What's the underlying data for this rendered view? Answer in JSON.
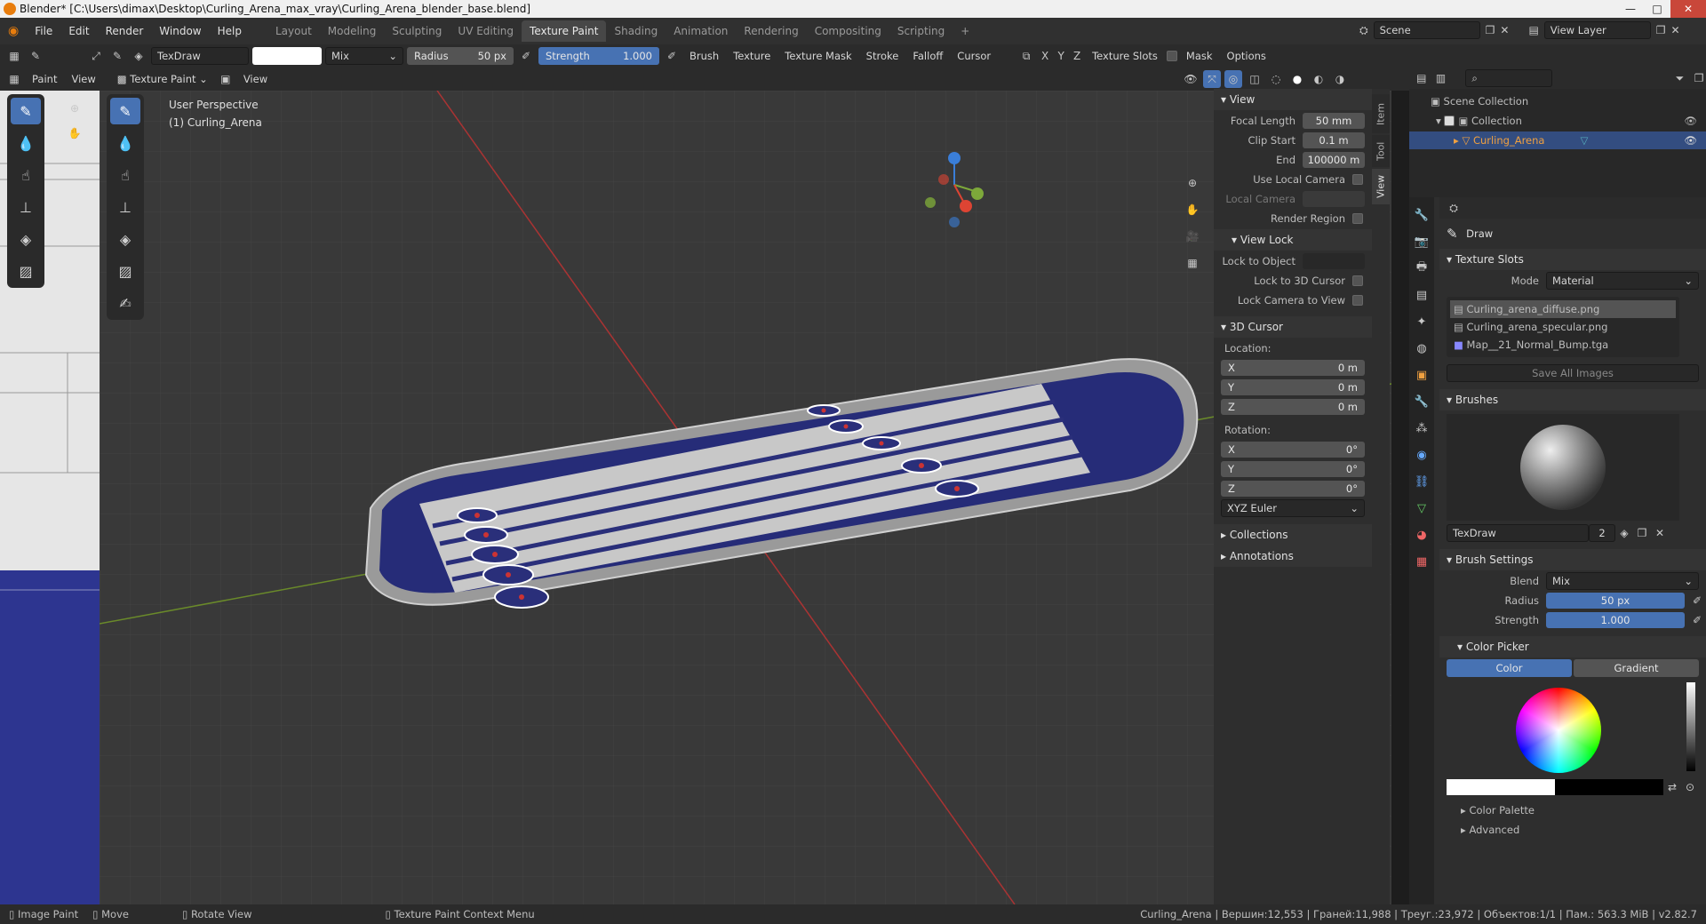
{
  "window": {
    "title": "Blender* [C:\\Users\\dimax\\Desktop\\Curling_Arena_max_vray\\Curling_Arena_blender_base.blend]",
    "minimize": "—",
    "maximize": "□",
    "close": "✕"
  },
  "menu": [
    "File",
    "Edit",
    "Render",
    "Window",
    "Help"
  ],
  "workspaces": [
    "Layout",
    "Modeling",
    "Sculpting",
    "UV Editing",
    "Texture Paint",
    "Shading",
    "Animation",
    "Rendering",
    "Compositing",
    "Scripting",
    "+"
  ],
  "active_workspace": "Texture Paint",
  "scene": {
    "name": "Scene",
    "view_layer": "View Layer"
  },
  "toolbar": {
    "brush_name": "TexDraw",
    "blend": "Mix",
    "radius_label": "Radius",
    "radius_value": "50 px",
    "strength_label": "Strength",
    "strength_value": "1.000",
    "menus": [
      "Brush",
      "Texture",
      "Texture Mask",
      "Stroke",
      "Falloff",
      "Cursor"
    ],
    "axes": [
      "X",
      "Y",
      "Z"
    ],
    "texture_slots": "Texture Slots",
    "mask": "Mask",
    "options": "Options"
  },
  "header2": {
    "mode_left": "Paint",
    "view_left": "View",
    "mode": "Texture Paint",
    "view": "View"
  },
  "viewport": {
    "perspective": "User Perspective",
    "object": "(1) Curling_Arena"
  },
  "npanel": {
    "tabs": [
      "Item",
      "Tool",
      "View"
    ],
    "view_section": "View",
    "focal_length_label": "Focal Length",
    "focal_length": "50 mm",
    "clip_start_label": "Clip Start",
    "clip_start": "0.1 m",
    "clip_end_label": "End",
    "clip_end": "100000 m",
    "use_local_camera": "Use Local Camera",
    "local_camera": "Local Camera",
    "render_region": "Render Region",
    "view_lock_section": "View Lock",
    "lock_to_object": "Lock to Object",
    "lock_3d_cursor": "Lock to 3D Cursor",
    "lock_camera": "Lock Camera to View",
    "cursor_section": "3D Cursor",
    "location": "Location:",
    "loc": [
      {
        "axis": "X",
        "val": "0 m"
      },
      {
        "axis": "Y",
        "val": "0 m"
      },
      {
        "axis": "Z",
        "val": "0 m"
      }
    ],
    "rotation": "Rotation:",
    "rot": [
      {
        "axis": "X",
        "val": "0°"
      },
      {
        "axis": "Y",
        "val": "0°"
      },
      {
        "axis": "Z",
        "val": "0°"
      }
    ],
    "rot_mode": "XYZ Euler",
    "collections": "Collections",
    "annotations": "Annotations"
  },
  "outliner": {
    "scene_collection": "Scene Collection",
    "collection": "Collection",
    "object": "Curling_Arena"
  },
  "properties": {
    "tool_name": "Draw",
    "texture_slots": "Texture Slots",
    "mode_label": "Mode",
    "mode": "Material",
    "slots": [
      "Curling_arena_diffuse.png",
      "Curling_arena_specular.png",
      "Map__21_Normal_Bump.tga"
    ],
    "save_all": "Save All Images",
    "brushes": "Brushes",
    "brush_name": "TexDraw",
    "brush_users": "2",
    "brush_settings": "Brush Settings",
    "blend_label": "Blend",
    "blend": "Mix",
    "radius_label": "Radius",
    "radius": "50 px",
    "strength_label": "Strength",
    "strength": "1.000",
    "color_picker": "Color Picker",
    "color_tab": "Color",
    "gradient_tab": "Gradient",
    "color_palette": "Color Palette",
    "advanced": "Advanced"
  },
  "status": {
    "image_paint": "Image Paint",
    "move": "Move",
    "rotate": "Rotate View",
    "context": "Texture Paint Context Menu",
    "stats": "Curling_Arena | Вершин:12,553 | Граней:11,988 | Треуг.:23,972 | Объектов:1/1 | Пам.: 563.3 MiB | v2.82.7"
  },
  "colors": {
    "accent": "#4772b3",
    "selected_row": "#334d80",
    "arena_blue": "#2a2f7a",
    "ice": "#c9c9c9"
  }
}
